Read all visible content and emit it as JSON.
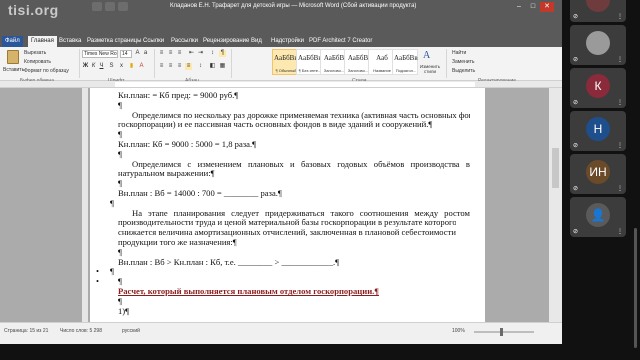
{
  "window": {
    "logo": "tisi.org",
    "title": "Кладанов Е.Н. Трафарет для детской игры — Microsoft Word (Сбой активации продукта)"
  },
  "tabs": [
    {
      "label": "Файл",
      "kind": "file"
    },
    {
      "label": "Главная",
      "kind": "active"
    },
    {
      "label": "Вставка",
      "kind": ""
    },
    {
      "label": "Разметка страницы",
      "kind": ""
    },
    {
      "label": "Ссылки",
      "kind": ""
    },
    {
      "label": "Рассылки",
      "kind": ""
    },
    {
      "label": "Рецензирование",
      "kind": ""
    },
    {
      "label": "Вид",
      "kind": ""
    },
    {
      "label": "Надстройки",
      "kind": ""
    },
    {
      "label": "PDF Architect 7 Creator",
      "kind": ""
    }
  ],
  "ribbon": {
    "paste": "Вставить",
    "cut": "Вырезать",
    "copy": "Копировать",
    "format_painter": "Формат по образцу",
    "clipboard": "Буфер обмена",
    "font_name": "Times New Ro",
    "font_size": "14",
    "font_group": "Шрифт",
    "paragraph_group": "Абзац",
    "styles_group": "Стили",
    "editing_group": "Редактирование",
    "change_styles": "Изменить стили",
    "find": "Найти",
    "replace": "Заменить",
    "select": "Выделить",
    "styles": [
      {
        "sample": "АаБбВвГ",
        "name": "¶ Обычный",
        "selected": true
      },
      {
        "sample": "АаБбВвГ",
        "name": "¶ Без инте...",
        "selected": false
      },
      {
        "sample": "АаБбВ",
        "name": "Заголово...",
        "selected": false
      },
      {
        "sample": "АаБбВ",
        "name": "Заголово...",
        "selected": false
      },
      {
        "sample": "Ааб",
        "name": "Название",
        "selected": false
      },
      {
        "sample": "АаБбВвІ",
        "name": "Подзагол...",
        "selected": false
      }
    ]
  },
  "document": {
    "lines": [
      {
        "text": "Кн.план: = Кб пред: =   9000   руб.¶",
        "cls": "",
        "x": 0
      },
      {
        "text": "¶",
        "cls": "",
        "x": 0
      },
      {
        "text": "Определимся по нескольку раз дорожке применяемая техника (активная часть основных фондов",
        "cls": "just",
        "x": 14
      },
      {
        "text": "госкорпорации) и ее пассивная часть основных фондов в виде зданий и сооружений.¶",
        "cls": "",
        "x": 0
      },
      {
        "text": "¶",
        "cls": "",
        "x": 0
      },
      {
        "text": "Кн.план: Кб = 9000 : 5000 = 1,8 раза.¶",
        "cls": "",
        "x": 0
      },
      {
        "text": "¶",
        "cls": "",
        "x": 0
      },
      {
        "text": "Определимся с изменением плановых и базовых годовых объёмов производства в",
        "cls": "just",
        "x": 14
      },
      {
        "text": "натуральном выражении:¶",
        "cls": "",
        "x": 0
      },
      {
        "text": "¶",
        "cls": "",
        "x": 0
      },
      {
        "text": "Вн.план : Вб = 14000 : 700 = ________ раза.¶",
        "cls": "",
        "x": 0
      },
      {
        "text": "¶",
        "cls": "",
        "x": -8
      },
      {
        "text": "На этапе планирования следует придерживаться такого соотношения между ростом",
        "cls": "just",
        "x": 14
      },
      {
        "text": "производительности труда и ценой материальной базы госкорпорации в результате которого",
        "cls": "just",
        "x": 0
      },
      {
        "text": "снижается величина амортизационных отчислений, заключенная в плановой себестоимости единицы",
        "cls": "just",
        "x": 0
      },
      {
        "text": "продукции того же назначения:¶",
        "cls": "",
        "x": 0
      },
      {
        "text": "¶",
        "cls": "",
        "x": 0
      },
      {
        "text": "Вн.план : Вб > Кн.план : Кб, т.е. ________ > ____________.¶",
        "cls": "",
        "x": 0
      },
      {
        "text": "¶",
        "cls": "",
        "x": -8
      },
      {
        "text": "¶",
        "cls": "",
        "x": 0
      },
      {
        "text": "Расчет, который выполняется плановым отделом госкорпорации.¶",
        "cls": "red",
        "x": 0
      },
      {
        "text": "¶",
        "cls": "",
        "x": 0
      },
      {
        "text": "1)¶",
        "cls": "",
        "x": 0
      }
    ]
  },
  "status": {
    "page": "Страница: 15 из 21",
    "words": "Число слов: 5 298",
    "language": "русский",
    "zoom": "100%"
  },
  "participants": [
    {
      "initials": "",
      "color": "#6e3c3c",
      "kind": "cut"
    },
    {
      "initials": "",
      "color": "#9a9a9a",
      "kind": "photo"
    },
    {
      "initials": "К",
      "color": "#8a2a3a",
      "kind": "letter"
    },
    {
      "initials": "Н",
      "color": "#1f4e8c",
      "kind": "letter"
    },
    {
      "initials": "ИН",
      "color": "#6b4a2a",
      "kind": "letter"
    },
    {
      "initials": "",
      "color": "#5a5a5a",
      "kind": "person"
    }
  ]
}
